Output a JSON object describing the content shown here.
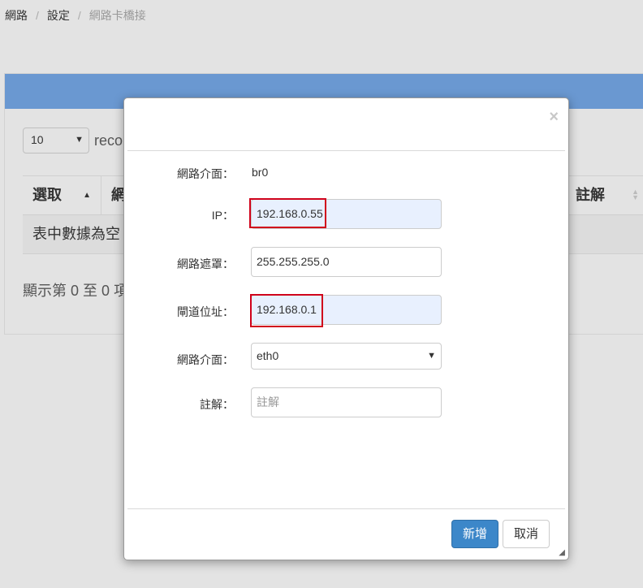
{
  "breadcrumb": {
    "items": [
      "網路",
      "設定",
      "網路卡橋接"
    ],
    "separator": "/"
  },
  "panel": {
    "page_length": "10",
    "records_text": "reco",
    "columns": [
      "選取",
      "網",
      "註解"
    ],
    "empty_message": "表中數據為空",
    "info_text": "顯示第 0 至 0 項"
  },
  "modal": {
    "close_label": "×",
    "fields": {
      "iface_label": "網路介面：",
      "iface_value": "br0",
      "ip_label": "IP：",
      "ip_value": "192.168.0.55",
      "mask_label": "網路遮罩：",
      "mask_value": "255.255.255.0",
      "gateway_label": "閘道位址：",
      "gateway_value": "192.168.0.1",
      "nic_label": "網路介面：",
      "nic_value": "eth0",
      "note_label": "註解：",
      "note_placeholder": "註解"
    },
    "buttons": {
      "add": "新增",
      "cancel": "取消"
    }
  },
  "colors": {
    "panel_header": "#6a98d1",
    "primary_button": "#3c87c9",
    "highlight": "#d0021b",
    "autofill": "#e8f0fe"
  },
  "icons": {
    "close": "close-icon",
    "sort_asc": "sort-asc-icon",
    "sort_both": "sort-both-icon",
    "chevron": "chevron-down-icon",
    "resize": "resize-grip-icon"
  }
}
